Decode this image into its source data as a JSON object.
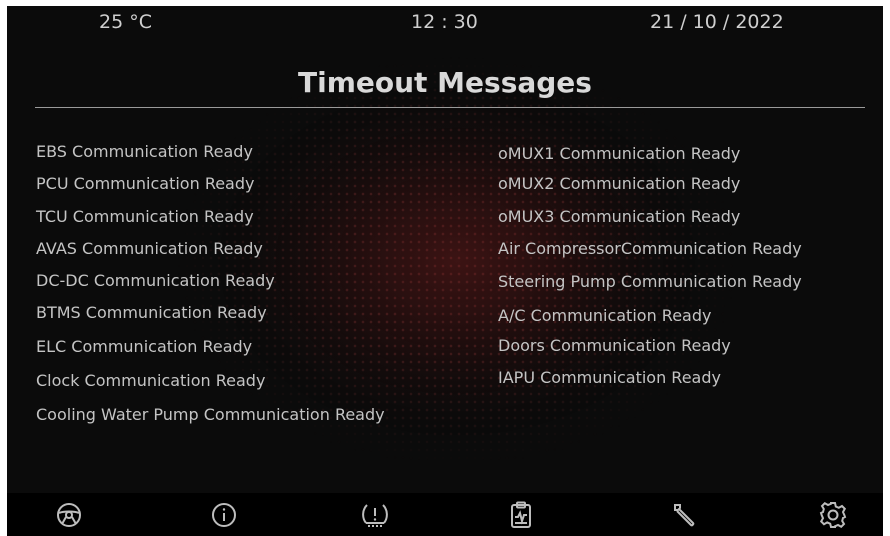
{
  "status": {
    "temperature": "25 °C",
    "time": "12 : 30",
    "date": "21 / 10 / 2022"
  },
  "page_title": "Timeout Messages",
  "messages_left": [
    "EBS Communication Ready",
    "PCU Communication Ready",
    "TCU Communication Ready",
    "AVAS Communication Ready",
    "DC-DC Communication Ready",
    "BTMS Communication Ready",
    "ELC Communication Ready",
    "Clock Communication Ready",
    "Cooling Water Pump Communication Ready"
  ],
  "messages_right": [
    "oMUX1 Communication Ready",
    "oMUX2 Communication Ready",
    "oMUX3 Communication Ready",
    "Air CompressorCommunication Ready",
    "Steering Pump Communication Ready",
    "A/C Communication Ready",
    "Doors Communication Ready",
    "IAPU Communication Ready"
  ],
  "nav_icons": [
    "steering-wheel-icon",
    "info-icon",
    "tire-pressure-icon",
    "clipboard-report-icon",
    "wrench-icon",
    "gear-icon"
  ]
}
